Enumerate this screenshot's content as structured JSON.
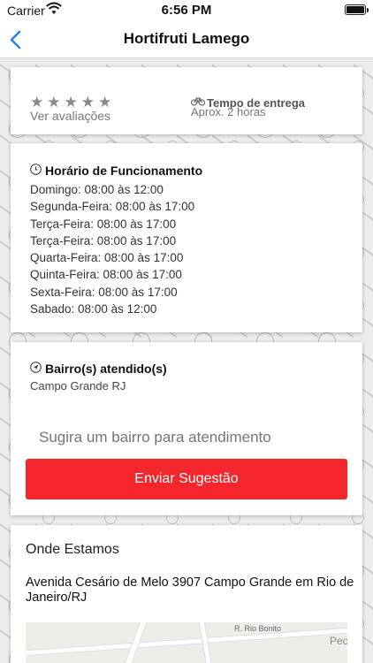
{
  "status": {
    "carrier": "Carrier",
    "time": "6:56 PM"
  },
  "nav": {
    "title": "Hortifruti Lamego"
  },
  "rating": {
    "stars": "★★★★★",
    "link": "Ver avaliações"
  },
  "delivery": {
    "title": "Tempo de entrega",
    "value": "Aprox. 2 horas"
  },
  "hours": {
    "title": "Horário de Funcionamento",
    "items": [
      "Domingo: 08:00 às 12:00",
      "Segunda-Feira: 08:00 às 17:00",
      "Terça-Feira: 08:00 às 17:00",
      "Terça-Feira: 08:00 às 17:00",
      "Quarta-Feira: 08:00 às 17:00",
      "Quinta-Feira: 08:00 às 17:00",
      "Sexta-Feira: 08:00 às 17:00",
      "Sabado: 08:00 às 12:00"
    ]
  },
  "bairros": {
    "title": "Bairro(s) atendido(s)",
    "value": "Campo Grande RJ",
    "suggest_placeholder": "Sugira um bairro para atendimento",
    "send_label": "Enviar Sugestão"
  },
  "location": {
    "title": "Onde Estamos",
    "address": "Avenida Cesário de Melo 3907 Campo Grande em Rio de Janeiro/RJ",
    "map_labels": [
      "R. Rio Bonito",
      "Pecs"
    ]
  },
  "colors": {
    "accent": "#f5262b",
    "back": "#2f80ed"
  }
}
